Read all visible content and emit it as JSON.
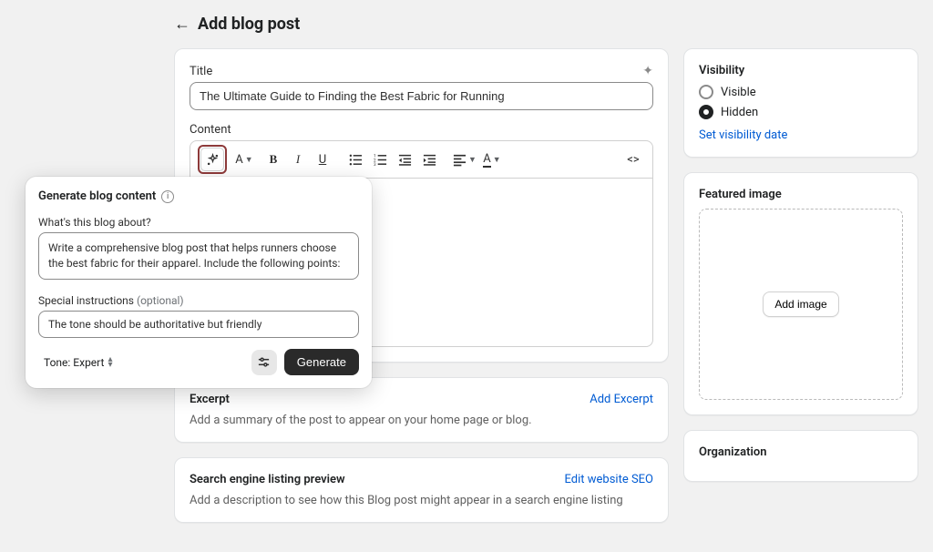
{
  "header": {
    "title": "Add blog post"
  },
  "title_section": {
    "label": "Title",
    "value": "The Ultimate Guide to Finding the Best Fabric for Running"
  },
  "content_section": {
    "label": "Content"
  },
  "toolbar": {
    "heading_letter": "A",
    "bold": "B",
    "italic": "I",
    "underline": "U",
    "align_letter": "A",
    "color_letter": "A",
    "source": "<>"
  },
  "popover": {
    "title": "Generate blog content",
    "about_label": "What's this blog about?",
    "about_value": "Write a comprehensive blog post that helps runners choose the best fabric for their apparel. Include the following points:",
    "instructions_label": "Special instructions ",
    "instructions_optional": "(optional)",
    "instructions_value": "The tone should be authoritative but friendly",
    "tone_label": "Tone: Expert",
    "generate_label": "Generate"
  },
  "excerpt": {
    "title": "Excerpt",
    "add_link": "Add Excerpt",
    "description": "Add a summary of the post to appear on your home page or blog."
  },
  "seo": {
    "title": "Search engine listing preview",
    "edit_link": "Edit website SEO",
    "description": "Add a description to see how this Blog post might appear in a search engine listing"
  },
  "visibility": {
    "heading": "Visibility",
    "visible_label": "Visible",
    "hidden_label": "Hidden",
    "set_date_link": "Set visibility date"
  },
  "featured": {
    "heading": "Featured image",
    "add_button": "Add image"
  },
  "organization": {
    "heading": "Organization"
  }
}
